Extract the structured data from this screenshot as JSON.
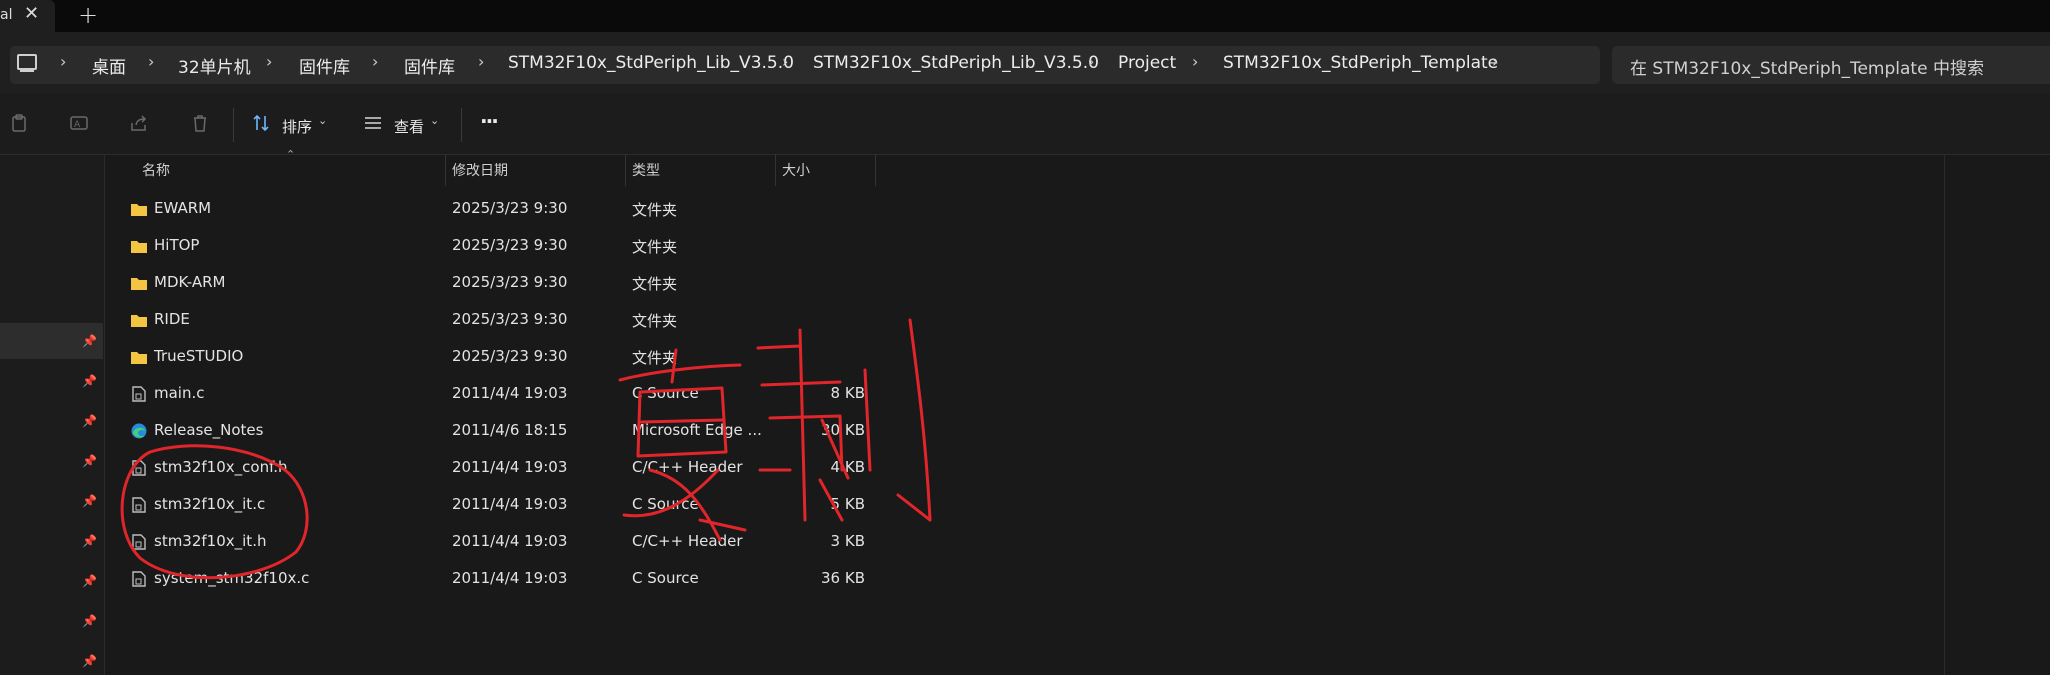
{
  "tab": {
    "title": "al",
    "close_icon": "close-icon",
    "new_tab_icon": "plus-icon"
  },
  "breadcrumb": {
    "items": [
      "桌面",
      "32单片机",
      "固件库",
      "固件库",
      "STM32F10x_StdPeriph_Lib_V3.5.0",
      "STM32F10x_StdPeriph_Lib_V3.5.0",
      "Project",
      "STM32F10x_StdPeriph_Template"
    ],
    "separator": "›"
  },
  "search": {
    "placeholder": "在 STM32F10x_StdPeriph_Template 中搜索"
  },
  "toolbar": {
    "sort_label": "排序",
    "view_label": "查看",
    "more_label": "···"
  },
  "columns": {
    "name": "名称",
    "modified": "修改日期",
    "type": "类型",
    "size": "大小"
  },
  "files": [
    {
      "name": "EWARM",
      "modified": "2025/3/23 9:30",
      "type": "文件夹",
      "size": "",
      "icon": "folder-icon"
    },
    {
      "name": "HiTOP",
      "modified": "2025/3/23 9:30",
      "type": "文件夹",
      "size": "",
      "icon": "folder-icon"
    },
    {
      "name": "MDK-ARM",
      "modified": "2025/3/23 9:30",
      "type": "文件夹",
      "size": "",
      "icon": "folder-icon"
    },
    {
      "name": "RIDE",
      "modified": "2025/3/23 9:30",
      "type": "文件夹",
      "size": "",
      "icon": "folder-icon"
    },
    {
      "name": "TrueSTUDIO",
      "modified": "2025/3/23 9:30",
      "type": "文件夹",
      "size": "",
      "icon": "folder-icon"
    },
    {
      "name": "main.c",
      "modified": "2011/4/4 19:03",
      "type": "C Source",
      "size": "8 KB",
      "icon": "file-icon"
    },
    {
      "name": "Release_Notes",
      "modified": "2011/4/6 18:15",
      "type": "Microsoft Edge ...",
      "size": "30 KB",
      "icon": "edge-icon"
    },
    {
      "name": "stm32f10x_conf.h",
      "modified": "2011/4/4 19:03",
      "type": "C/C++ Header",
      "size": "4 KB",
      "icon": "file-icon"
    },
    {
      "name": "stm32f10x_it.c",
      "modified": "2011/4/4 19:03",
      "type": "C Source",
      "size": "5 KB",
      "icon": "file-icon"
    },
    {
      "name": "stm32f10x_it.h",
      "modified": "2011/4/4 19:03",
      "type": "C/C++ Header",
      "size": "3 KB",
      "icon": "file-icon"
    },
    {
      "name": "system_stm32f10x.c",
      "modified": "2011/4/4 19:03",
      "type": "C Source",
      "size": "36 KB",
      "icon": "file-icon"
    }
  ],
  "annotation": {
    "text": "复制",
    "color": "#e0262a"
  },
  "colors": {
    "folder": "#f4c542",
    "accent": "#4aa3df",
    "annotation": "#e0262a"
  }
}
